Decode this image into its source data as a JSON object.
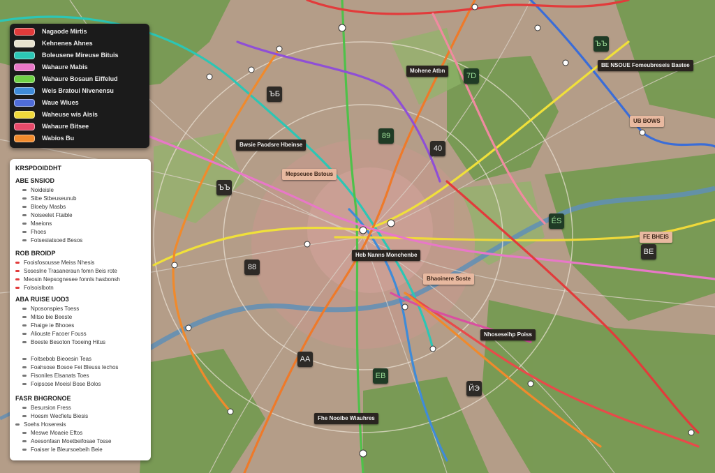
{
  "dark_legend": {
    "items": [
      {
        "label": "Nagaode Mirtis",
        "color": "#e23b3b"
      },
      {
        "label": "Kehnenes Ahnes",
        "color": "#e8e2cf"
      },
      {
        "label": "Boleusene Mireuse Bituis",
        "color": "#2cc6b5"
      },
      {
        "label": "Wahaure Mabis",
        "color": "#e878c8"
      },
      {
        "label": "Wahaure Bosaun Eiffelud",
        "color": "#6fd146"
      },
      {
        "label": "Weis Bratoui Nivenensu",
        "color": "#3f8bd8"
      },
      {
        "label": "Waue Wiues",
        "color": "#4f6cd9"
      },
      {
        "label": "Waheuse wis Aisis",
        "color": "#f0d93c"
      },
      {
        "label": "Wahaure Bitsee",
        "color": "#e84a6a"
      },
      {
        "label": "Wabios Bu",
        "color": "#f08a2c"
      }
    ]
  },
  "white_legend": {
    "sections": [
      {
        "heading": "KRSPDOIDDHT",
        "items": []
      },
      {
        "heading": "ABE SNSIOD",
        "items": [
          "Noideisle",
          "Sibe Stbeuseunub",
          "Bloeby Masbs",
          "Noiseelet Ftaible",
          "Maeions",
          "Fhoes",
          "Fotsesiatsoed Besos"
        ]
      },
      {
        "heading": "ROB BROIDP",
        "items": [
          "Fooisfosousse Meiss Nhesis",
          "Soseslne Trasaneraun fomn Beis rote",
          "Meosin Nepsognesee fonnls hasbonsh",
          "Folsoislbotn"
        ]
      },
      {
        "heading": "ABA RUISE UOD3",
        "items": [
          "Nposonspies Toess",
          "Mitso bie Beeste",
          "Fhaige ie Bhooes",
          "Aliouste Facoer Fouss",
          "Boeste Besoton Tooeing Hitus",
          "Foitsebob Bieoesin Teas",
          "Foahsose Bosoe Fei Bleuss Iechos",
          "Fisoniles Elsanats Toes",
          "Foipsose Moeisl Bose Bolos"
        ]
      },
      {
        "heading": "FASR BHGRONOE",
        "items": [
          "Besursion Fress",
          "Hoesm Wecfietu Biesis",
          "Soehs Hoseresis",
          "Meswe Moaeie Eftos",
          "Aoesonfasn Moetbeifosae Tosse",
          "Foaiser Ie Bleursoebeih Beie"
        ]
      }
    ]
  },
  "callouts": [
    {
      "label": "Mohene Atbn",
      "style": "dark"
    },
    {
      "label": "Bwsie Paodsre Hbeinse",
      "style": "dark"
    },
    {
      "label": "Mepseuee Bstous",
      "style": "light"
    },
    {
      "label": "Bhaoinere Soste",
      "style": "light"
    },
    {
      "label": "Nhoseseihp Poiss",
      "style": "dark"
    },
    {
      "label": "BE NSOUE Fomeubreseis Bastee",
      "style": "dark"
    },
    {
      "label": "Heb Nanns Monchenbe",
      "style": "dark"
    },
    {
      "label": "UB BOWS",
      "style": "dark"
    },
    {
      "label": "FE BHEIS",
      "style": "light"
    },
    {
      "label": "Fhe Nooibe Wiauhres",
      "style": "dark"
    }
  ],
  "station_icons": [
    "ЪБ",
    "89",
    "40",
    "7D",
    "ЪЪ",
    "88",
    "ÉS",
    "BE",
    "AA",
    "EB",
    "ЙЭ",
    "ЪЪ"
  ]
}
